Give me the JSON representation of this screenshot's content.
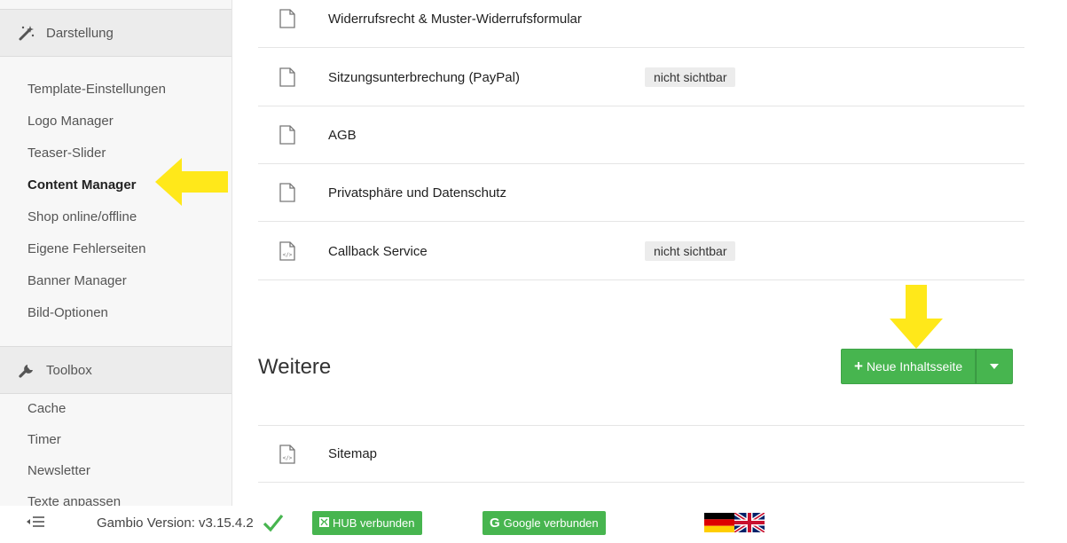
{
  "sidebar": {
    "sections": [
      {
        "title": "Darstellung",
        "icon": "magic-wand-icon",
        "items": [
          "Template-Einstellungen",
          "Logo Manager",
          "Teaser-Slider",
          "Content Manager",
          "Shop online/offline",
          "Eigene Fehlerseiten",
          "Banner Manager",
          "Bild-Optionen"
        ]
      },
      {
        "title": "Toolbox",
        "icon": "wrench-icon",
        "items": [
          "Cache",
          "Timer",
          "Newsletter",
          "Texte anpassen"
        ]
      }
    ],
    "active_item": "Content Manager"
  },
  "content": {
    "rows": [
      {
        "title": "Widerrufsrecht & Muster-Widerrufsformular",
        "icon": "document-icon",
        "badge": ""
      },
      {
        "title": "Sitzungsunterbrechung (PayPal)",
        "icon": "document-icon",
        "badge": "nicht sichtbar"
      },
      {
        "title": "AGB",
        "icon": "document-icon",
        "badge": ""
      },
      {
        "title": "Privatsphäre und Datenschutz",
        "icon": "document-icon",
        "badge": ""
      },
      {
        "title": "Callback Service",
        "icon": "code-document-icon",
        "badge": "nicht sichtbar"
      }
    ],
    "section_title": "Weitere",
    "new_page_button": "Neue Inhaltsseite",
    "other_rows": [
      {
        "title": "Sitemap",
        "icon": "code-document-icon",
        "badge": ""
      }
    ]
  },
  "footer": {
    "version": "Gambio Version: v3.15.4.2",
    "hub": "HUB verbunden",
    "google": "Google verbunden",
    "languages": [
      "de",
      "en"
    ]
  },
  "colors": {
    "accent_green": "#47b54f",
    "annotation_yellow": "#ffe81a"
  }
}
